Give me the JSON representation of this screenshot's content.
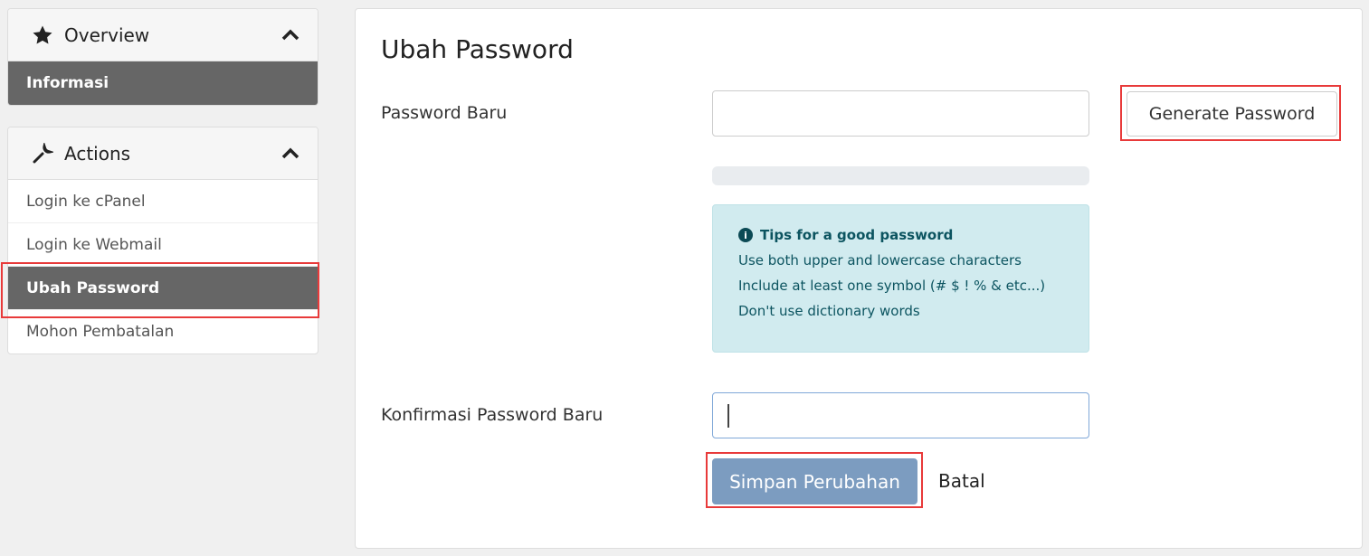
{
  "sidebar": {
    "overview": {
      "title": "Overview",
      "icon": "star-icon",
      "items": [
        {
          "label": "Informasi",
          "active": true
        }
      ]
    },
    "actions": {
      "title": "Actions",
      "icon": "wrench-icon",
      "items": [
        {
          "label": "Login ke cPanel",
          "active": false
        },
        {
          "label": "Login ke Webmail",
          "active": false
        },
        {
          "label": "Ubah Password",
          "active": true
        },
        {
          "label": "Mohon Pembatalan",
          "active": false
        }
      ]
    }
  },
  "main": {
    "title": "Ubah Password",
    "new_password_label": "Password Baru",
    "new_password_value": "",
    "generate_label": "Generate Password",
    "strength_percent": 0,
    "tips": {
      "title": "Tips for a good password",
      "items": [
        "Use both upper and lowercase characters",
        "Include at least one symbol (# $ ! % & etc...)",
        "Don't use dictionary words"
      ]
    },
    "confirm_label": "Konfirmasi Password Baru",
    "confirm_value": "",
    "save_label": "Simpan Perubahan",
    "cancel_label": "Batal"
  },
  "colors": {
    "highlight": "#e83a3a",
    "active_item": "#666666",
    "save_button": "#7c9cc0",
    "tips_bg": "#d1ebef"
  }
}
